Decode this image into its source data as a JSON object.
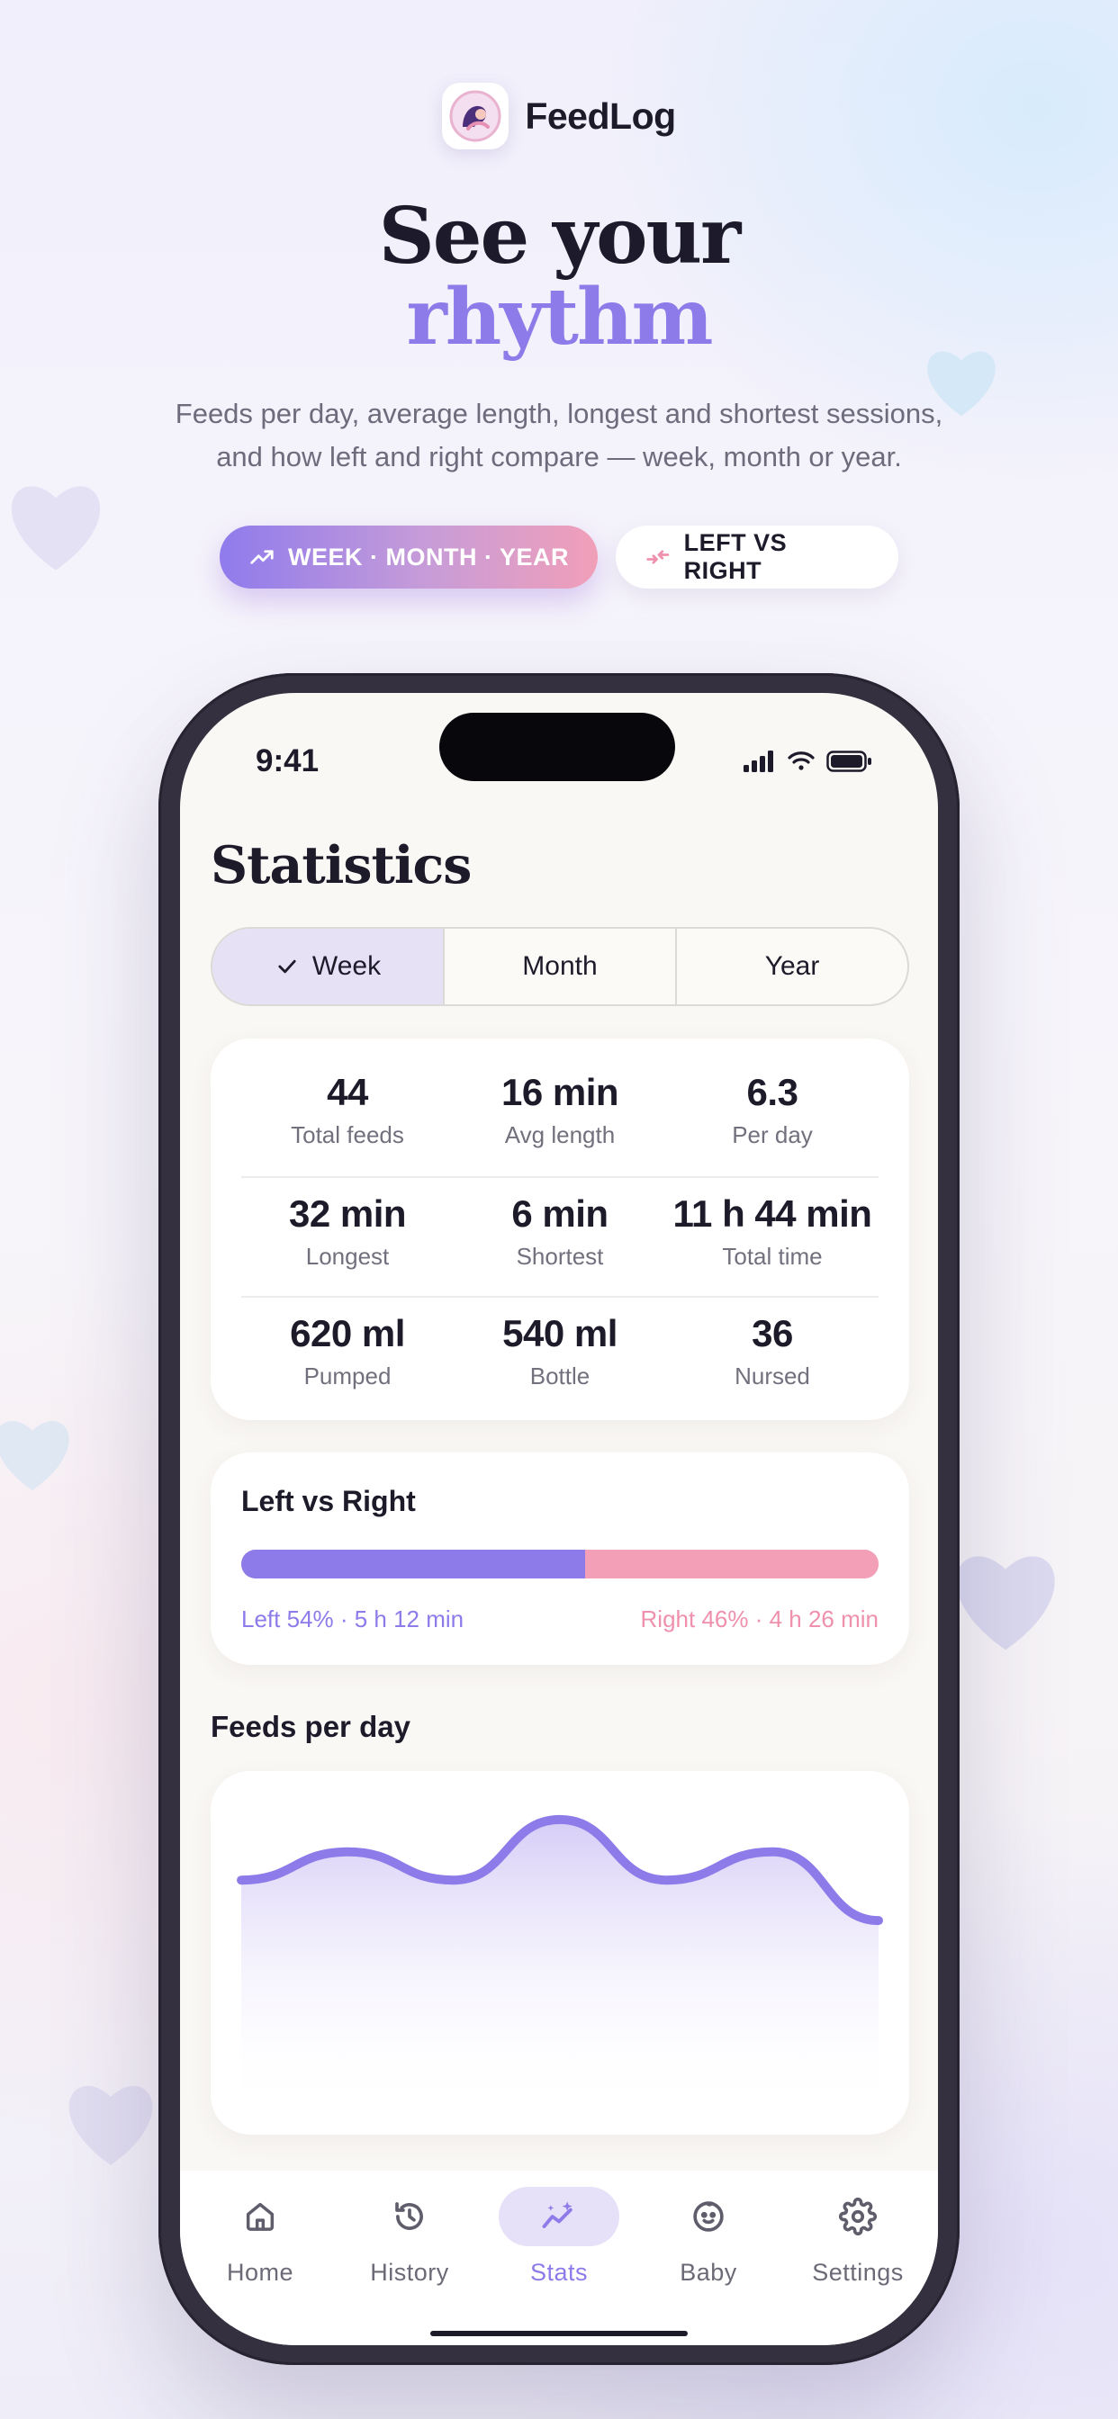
{
  "app": {
    "name": "FeedLog"
  },
  "hero": {
    "line1": "See your",
    "line2": "rhythm",
    "subtitle": "Feeds per day, average length, longest and shortest sessions, and how left and right compare — week, month or year.",
    "pill_primary": "WEEK · MONTH · YEAR",
    "pill_secondary": "LEFT VS RIGHT"
  },
  "status_bar": {
    "time": "9:41"
  },
  "screen": {
    "title": "Statistics",
    "segments": [
      "Week",
      "Month",
      "Year"
    ],
    "selected_segment": "Week"
  },
  "stats": [
    [
      {
        "value": "44",
        "label": "Total feeds"
      },
      {
        "value": "16 min",
        "label": "Avg length"
      },
      {
        "value": "6.3",
        "label": "Per day"
      }
    ],
    [
      {
        "value": "32 min",
        "label": "Longest"
      },
      {
        "value": "6 min",
        "label": "Shortest"
      },
      {
        "value": "11 h 44 min",
        "label": "Total time"
      }
    ],
    [
      {
        "value": "620 ml",
        "label": "Pumped"
      },
      {
        "value": "540 ml",
        "label": "Bottle"
      },
      {
        "value": "36",
        "label": "Nursed"
      }
    ]
  ],
  "left_right": {
    "title": "Left vs Right",
    "left_percent": 54,
    "right_percent": 46,
    "left_label": "Left 54% · 5 h 12 min",
    "right_label": "Right 46% · 4 h 26 min",
    "left_color": "#8e7bea",
    "right_color": "#f29fb7"
  },
  "feeds_chart": {
    "title": "Feeds per day"
  },
  "chart_data": {
    "type": "area",
    "title": "Feeds per day",
    "values": [
      6.3,
      7.0,
      6.3,
      7.8,
      6.3,
      7.0,
      5.3
    ],
    "ylim": [
      0,
      9
    ],
    "grid": false,
    "line_color": "#8e7bea"
  },
  "tabbar": {
    "items": [
      {
        "label": "Home",
        "icon": "home-icon"
      },
      {
        "label": "History",
        "icon": "history-icon"
      },
      {
        "label": "Stats",
        "icon": "stats-icon"
      },
      {
        "label": "Baby",
        "icon": "baby-icon"
      },
      {
        "label": "Settings",
        "icon": "settings-icon"
      }
    ],
    "active": "Stats"
  }
}
